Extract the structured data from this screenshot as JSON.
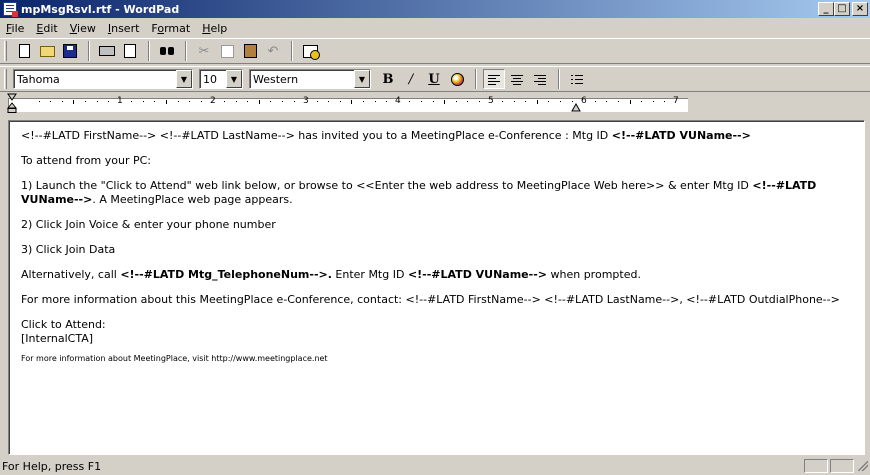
{
  "window": {
    "title": "mpMsgRsvl.rtf - WordPad",
    "minimize": "_",
    "maximize": "□",
    "close": "×"
  },
  "menu": [
    {
      "pre": "",
      "ul": "F",
      "post": "ile"
    },
    {
      "pre": "",
      "ul": "E",
      "post": "dit"
    },
    {
      "pre": "",
      "ul": "V",
      "post": "iew"
    },
    {
      "pre": "",
      "ul": "I",
      "post": "nsert"
    },
    {
      "pre": "F",
      "ul": "o",
      "post": "rmat"
    },
    {
      "pre": "",
      "ul": "H",
      "post": "elp"
    }
  ],
  "format": {
    "font": "Tahoma",
    "size": "10",
    "script": "Western",
    "bold": "B",
    "italic": "/",
    "underline": "U"
  },
  "ruler": {
    "numbers": [
      "1",
      "2",
      "3",
      "4",
      "5",
      "6",
      "7"
    ]
  },
  "document": {
    "p1a": "<!--#LATD FirstName--> <!--#LATD LastName--> has invited you to a MeetingPlace e-Conference : Mtg ID ",
    "p1b": "<!--#LATD VUName-->",
    "p2": "To attend from your PC:",
    "p3a": "1) Launch the \"Click to Attend\" web link below, or browse to <<Enter the web address to MeetingPlace Web here>> & enter Mtg ID ",
    "p3b": "<!--#LATD VUName-->",
    "p3c": ". A MeetingPlace web page appears.",
    "p4": "2) Click Join Voice & enter your phone number",
    "p5": "3) Click Join Data",
    "p6a": "Alternatively, call ",
    "p6b": "<!--#LATD Mtg_TelephoneNum-->.",
    "p6c": " Enter Mtg ID ",
    "p6d": "<!--#LATD VUName-->",
    "p6e": " when prompted.",
    "p7": "For more information about this MeetingPlace e-Conference, contact: <!--#LATD FirstName--> <!--#LATD LastName-->, <!--#LATD OutdialPhone-->",
    "p8a": "Click to Attend:",
    "p8b": "[InternalCTA]",
    "p9": "For more information about MeetingPlace, visit http://www.meetingplace.net"
  },
  "status": {
    "text": "For Help, press F1"
  }
}
